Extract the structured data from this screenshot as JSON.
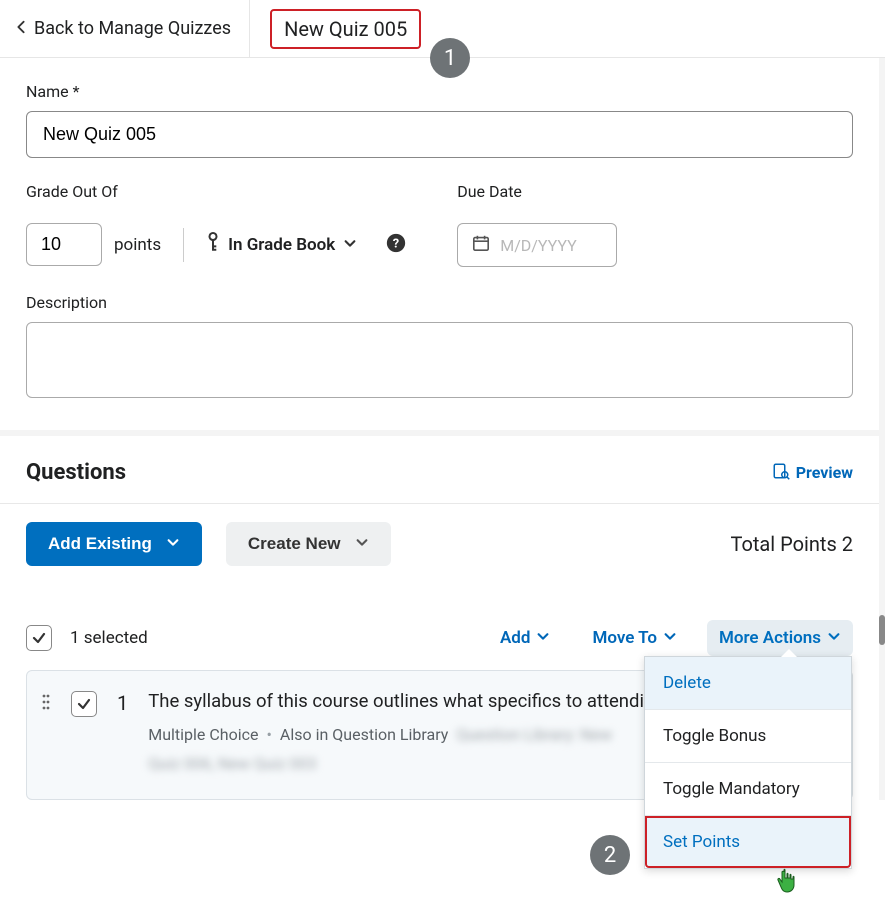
{
  "header": {
    "back_label": "Back to Manage Quizzes",
    "title": "New Quiz 005"
  },
  "annotations": {
    "badge1": "1",
    "badge2": "2"
  },
  "form": {
    "name_label": "Name",
    "name_value": "New Quiz 005",
    "grade_label": "Grade Out Of",
    "grade_value": "10",
    "points_word": "points",
    "gradebook_label": "In Grade Book",
    "due_label": "Due Date",
    "due_placeholder": "M/D/YYYY",
    "description_label": "Description",
    "description_value": ""
  },
  "questions": {
    "heading": "Questions",
    "preview_label": "Preview",
    "add_existing_label": "Add Existing",
    "create_new_label": "Create New",
    "total_points_label": "Total Points 2",
    "selected_label": "1 selected",
    "toolbar": {
      "add_label": "Add",
      "move_to_label": "Move To",
      "more_actions_label": "More Actions"
    },
    "item": {
      "number": "1",
      "text": "The syllabus of this course outlines what specifics to attendi",
      "type": "Multiple Choice",
      "also_in": "Also in Question Library",
      "redacted1": "Question Library: New",
      "redacted2": "Quiz 006, New Quiz 003"
    }
  },
  "dropdown": {
    "delete": "Delete",
    "toggle_bonus": "Toggle Bonus",
    "toggle_mandatory": "Toggle Mandatory",
    "set_points": "Set Points"
  }
}
